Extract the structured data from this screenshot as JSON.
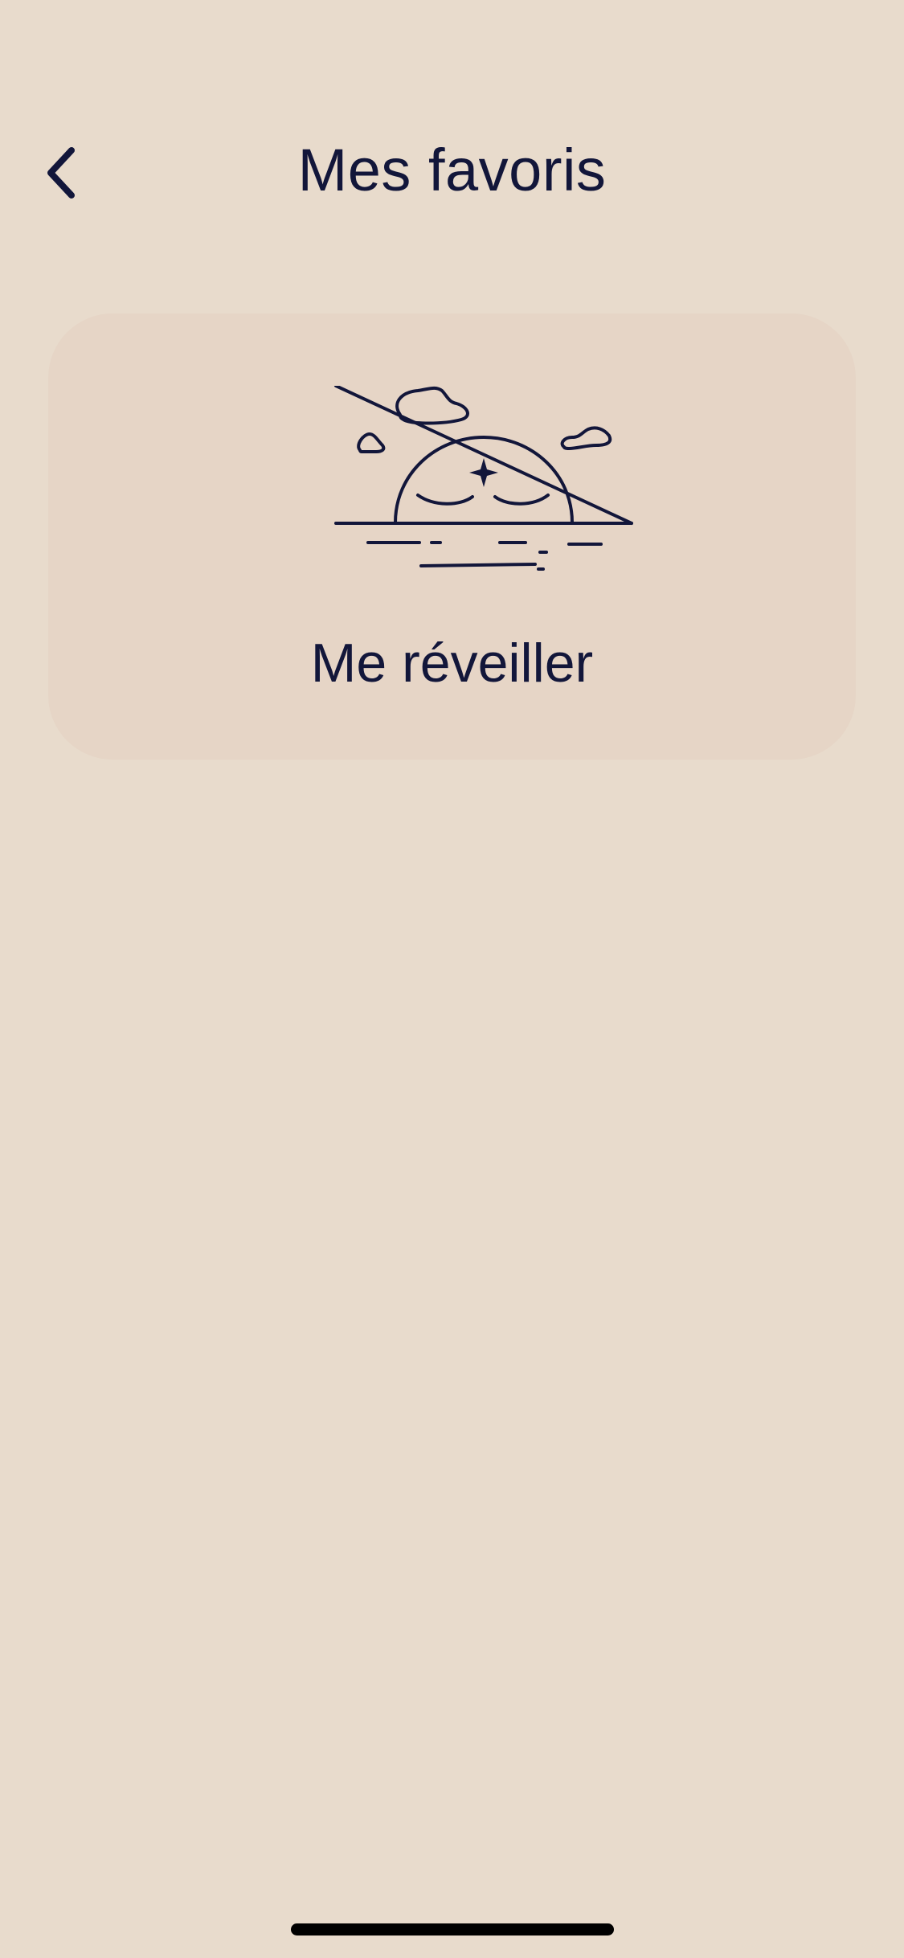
{
  "header": {
    "title": "Mes favoris",
    "back_icon": "chevron-left-icon"
  },
  "favorites": [
    {
      "label": "Me réveiller",
      "icon": "sunrise-icon"
    }
  ],
  "colors": {
    "background": "#e8dbcc",
    "card": "#e6d5c6",
    "text": "#12163a"
  }
}
